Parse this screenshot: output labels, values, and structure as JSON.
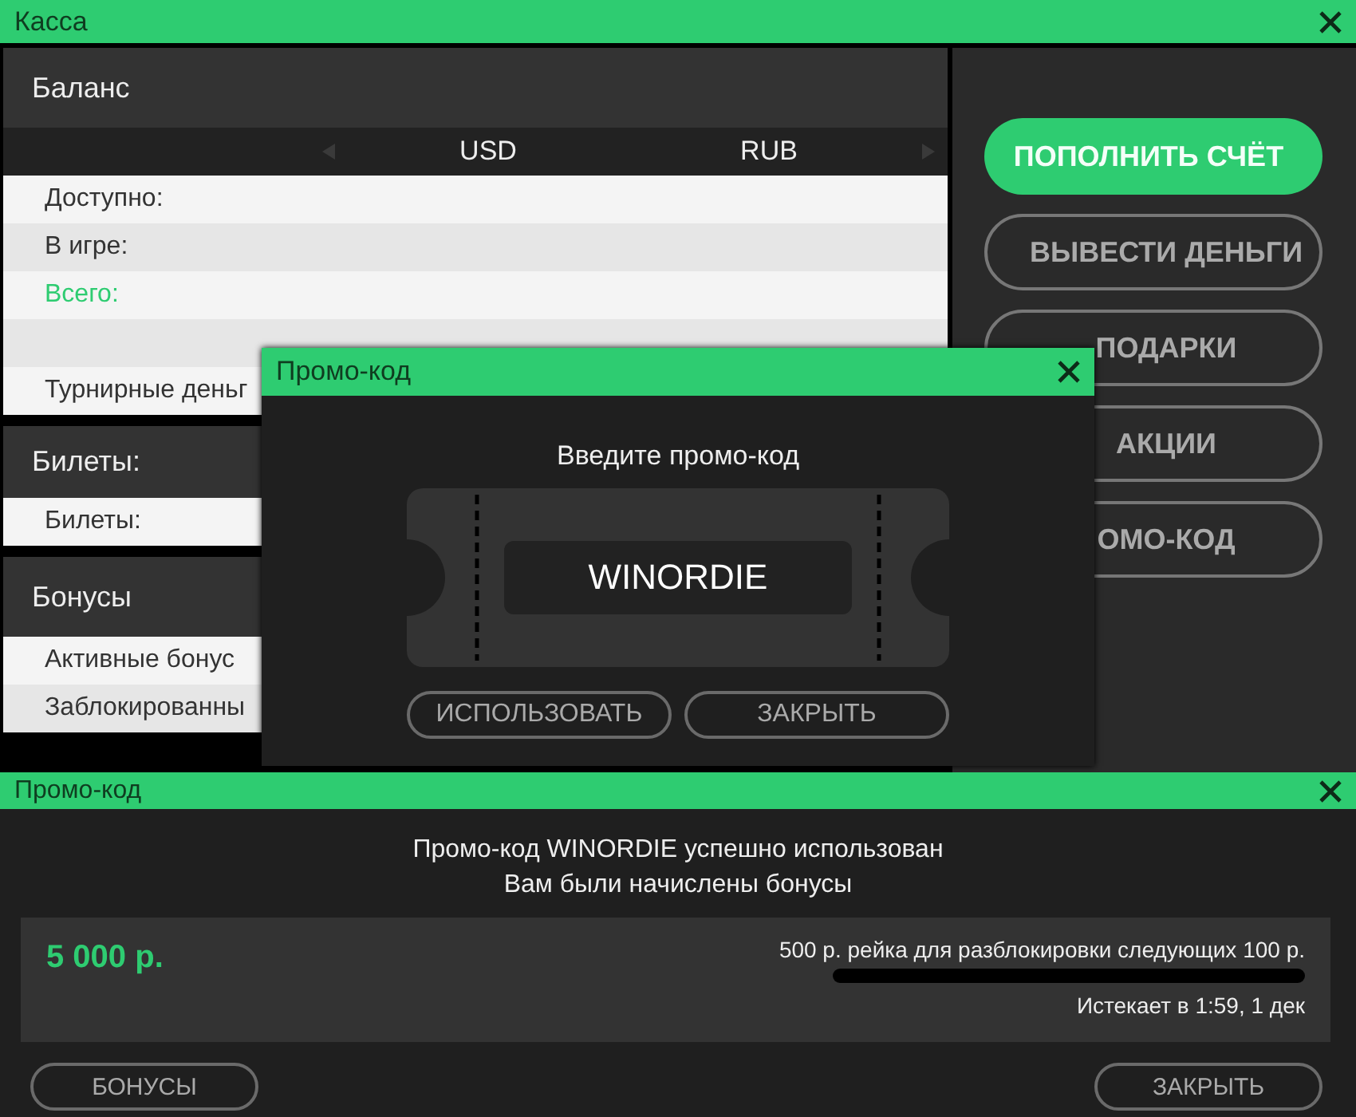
{
  "window": {
    "title": "Касса"
  },
  "balance": {
    "title": "Баланс",
    "currencies": [
      "USD",
      "RUB"
    ],
    "rows": [
      {
        "kind": "text",
        "label": "Доступно:",
        "accent": false
      },
      {
        "kind": "text",
        "label": "В игре:",
        "accent": false
      },
      {
        "kind": "text",
        "label": "Всего:",
        "accent": true
      },
      {
        "kind": "blank"
      },
      {
        "kind": "text",
        "label": "Турнирные деньг",
        "accent": false
      }
    ]
  },
  "tickets": {
    "title": "Билеты:",
    "rows": [
      {
        "label": "Билеты:",
        "accent": false
      }
    ]
  },
  "bonuses": {
    "title": "Бонусы",
    "rows": [
      {
        "label": "Активные бонус",
        "accent": false
      },
      {
        "label": "Заблокированны",
        "accent": false
      }
    ]
  },
  "actions": [
    {
      "label": "ПОПОЛНИТЬ СЧЁТ",
      "primary": true
    },
    {
      "label": "ВЫВЕСТИ ДЕНЬГИ",
      "primary": false
    },
    {
      "label": "ПОДАРКИ",
      "primary": false
    },
    {
      "label": "АКЦИИ",
      "primary": false
    },
    {
      "label": "ОМО-КОД",
      "primary": false
    }
  ],
  "promo_dialog": {
    "title": "Промо-код",
    "prompt": "Введите промо-код",
    "code": "WINORDIE",
    "buttons": [
      "ИСПОЛЬЗОВАТЬ",
      "ЗАКРЫТЬ"
    ]
  },
  "result_panel": {
    "title": "Промо-код",
    "message": [
      "Промо-код WINORDIE успешно использован",
      "Вам были начислены бонусы"
    ],
    "bonus": {
      "amount": "5 000 р.",
      "requirement": "500 р. рейка для разблокировки следующих 100 р.",
      "level": 0,
      "expires": "Истекает в 1:59, 1 дек"
    },
    "buttons": [
      "БОНУСЫ",
      "ЗАКРЫТЬ"
    ]
  }
}
